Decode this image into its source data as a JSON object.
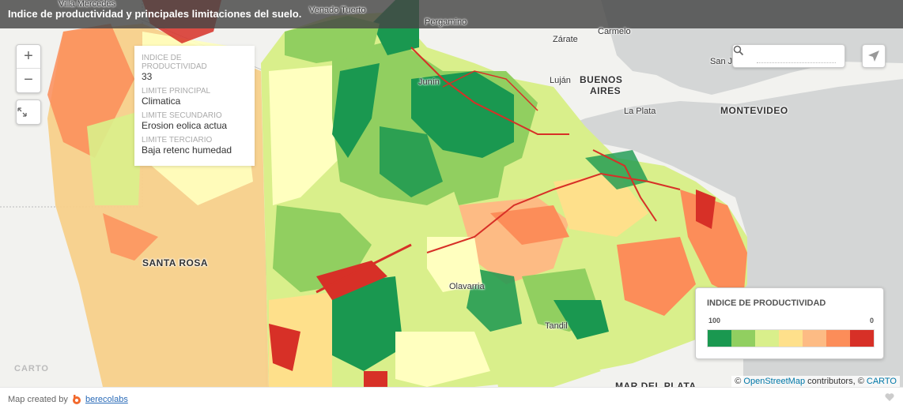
{
  "title": "Indice de productividad y principales limitaciones del suelo.",
  "cities": [
    {
      "name": "Villa Mercedes",
      "big": false
    },
    {
      "name": "Venado Tuerto",
      "big": false
    },
    {
      "name": "Pergamino",
      "big": false
    },
    {
      "name": "Zárate",
      "big": false
    },
    {
      "name": "Carmelo",
      "big": false
    },
    {
      "name": "San J",
      "big": false
    },
    {
      "name": "Junín",
      "big": false
    },
    {
      "name": "Luján",
      "big": false
    },
    {
      "name": "BUENOS",
      "big": true
    },
    {
      "name": "AIRES",
      "big": true
    },
    {
      "name": "La Plata",
      "big": false
    },
    {
      "name": "MONTEVIDEO",
      "big": true
    },
    {
      "name": "SANTA ROSA",
      "big": true
    },
    {
      "name": "Olavarria",
      "big": false
    },
    {
      "name": "Tandil",
      "big": false
    },
    {
      "name": "MAR DEL PLATA",
      "big": true
    }
  ],
  "zoom": {
    "in_label": "+",
    "out_label": "−"
  },
  "icons": {
    "fullscreen": "fullscreen-icon",
    "search": "search-icon",
    "share": "share-icon",
    "heart": "heart-icon",
    "brand": "berecolabs-logo-icon"
  },
  "infowindow": {
    "fields": [
      {
        "label": "INDICE DE PRODUCTIVIDAD",
        "value": "33"
      },
      {
        "label": "LIMITE PRINCIPAL",
        "value": "Climatica"
      },
      {
        "label": "LIMITE SECUNDARIO",
        "value": "Erosion eolica actua"
      },
      {
        "label": "LIMITE TERCIARIO",
        "value": "Baja retenc humedad"
      }
    ]
  },
  "search": {
    "placeholder": ""
  },
  "legend": {
    "title": "INDICE DE PRODUCTIVIDAD",
    "left_label": "100",
    "right_label": "0",
    "colors": [
      "#1a9850",
      "#91cf60",
      "#d9ef8b",
      "#fee08b",
      "#fdbb84",
      "#fc8d59",
      "#d73027"
    ]
  },
  "attribution": {
    "prefix": "©",
    "osm": "OpenStreetMap",
    "middle": "contributors, ©",
    "carto": "CARTO"
  },
  "carto_watermark": "CARTO",
  "footer": {
    "text": "Map created by",
    "brand": "berecolabs"
  },
  "colors": {
    "water": "#d4d6d6",
    "land": "#f2f2ef",
    "title_bg": "#464646"
  }
}
